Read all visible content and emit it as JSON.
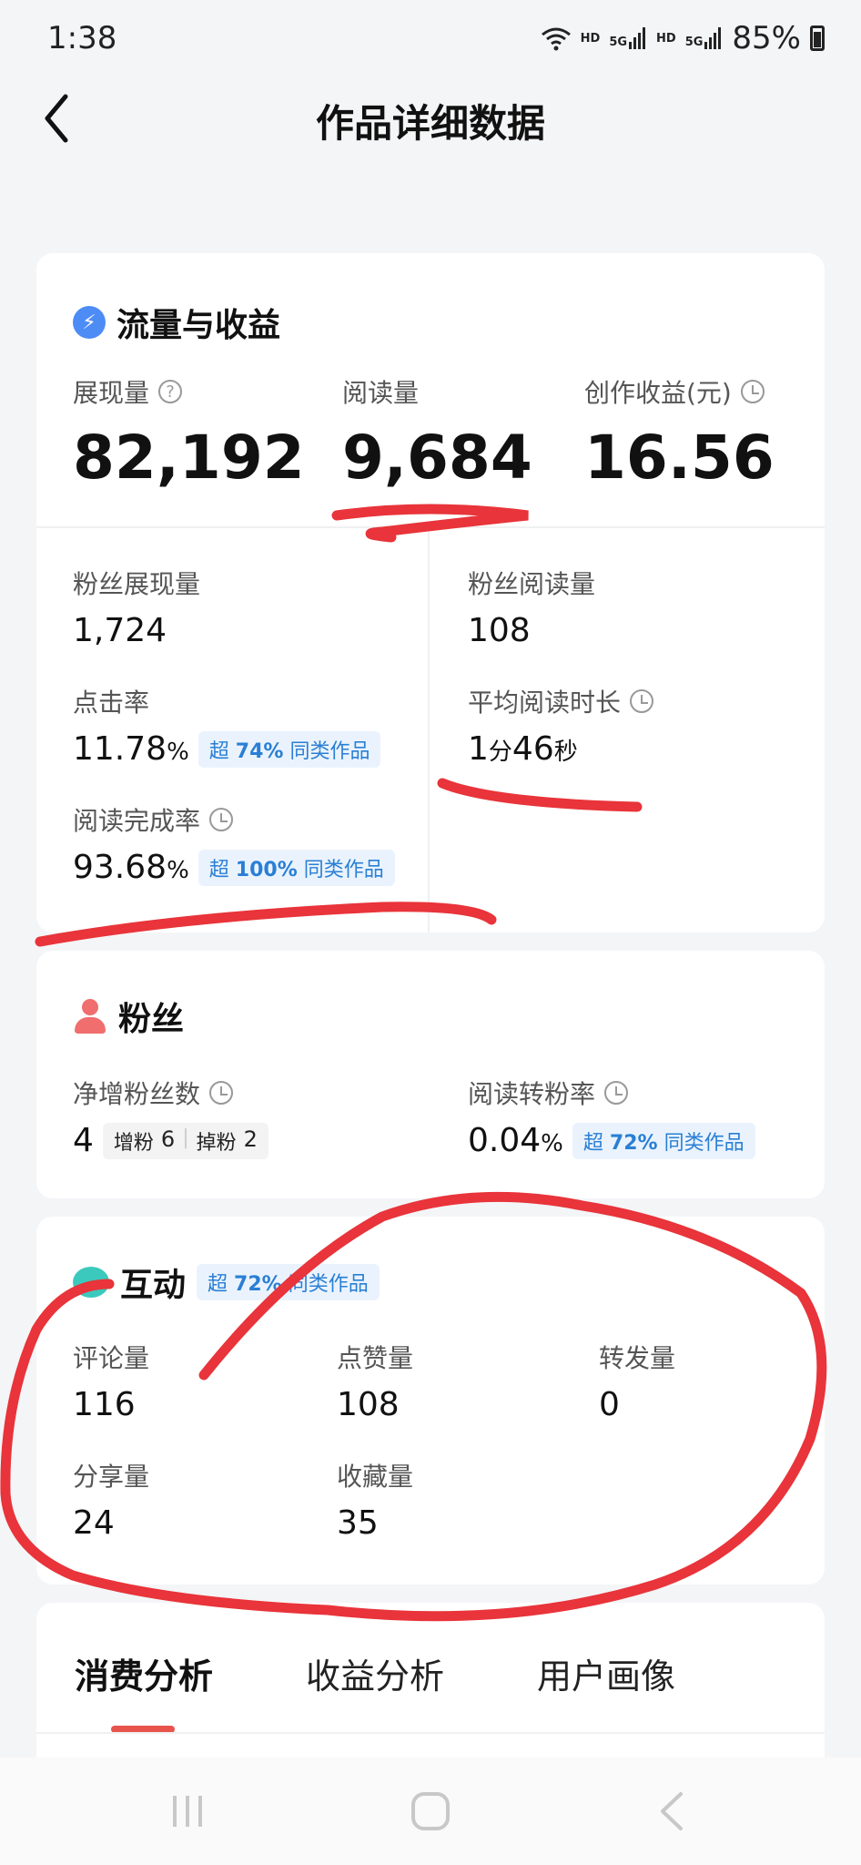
{
  "status_bar": {
    "time": "1:38",
    "net1": "HD",
    "net1_sig": "5G",
    "net2": "HD",
    "net2_sig": "5G",
    "battery": "85%"
  },
  "header": {
    "title": "作品详细数据",
    "back_icon": "back-arrow-icon"
  },
  "traffic": {
    "title": "流量与收益",
    "impressions_label": "展现量",
    "impressions_value": "82,192",
    "reads_label": "阅读量",
    "reads_value": "9,684",
    "revenue_label": "创作收益(元)",
    "revenue_value": "16.56",
    "fan_impressions_label": "粉丝展现量",
    "fan_impressions_value": "1,724",
    "fan_reads_label": "粉丝阅读量",
    "fan_reads_value": "108",
    "ctr_label": "点击率",
    "ctr_value": "11.78",
    "ctr_unit": "%",
    "ctr_badge_prefix": "超",
    "ctr_badge_pct": "74%",
    "ctr_badge_suffix": "同类作品",
    "avg_read_label": "平均阅读时长",
    "avg_read_min": "1",
    "avg_read_min_unit": "分",
    "avg_read_sec": "46",
    "avg_read_sec_unit": "秒",
    "completion_label": "阅读完成率",
    "completion_value": "93.68",
    "completion_unit": "%",
    "completion_badge_prefix": "超",
    "completion_badge_pct": "100%",
    "completion_badge_suffix": "同类作品"
  },
  "fans": {
    "title": "粉丝",
    "net_label": "净增粉丝数",
    "net_value": "4",
    "gain_label": "增粉",
    "gain_value": "6",
    "loss_label": "掉粉",
    "loss_value": "2",
    "conv_label": "阅读转粉率",
    "conv_value": "0.04",
    "conv_unit": "%",
    "conv_badge_prefix": "超",
    "conv_badge_pct": "72%",
    "conv_badge_suffix": "同类作品"
  },
  "interaction": {
    "title": "互动",
    "badge_prefix": "超",
    "badge_pct": "72%",
    "badge_suffix": "同类作品",
    "comments_label": "评论量",
    "comments_value": "116",
    "likes_label": "点赞量",
    "likes_value": "108",
    "reposts_label": "转发量",
    "reposts_value": "0",
    "shares_label": "分享量",
    "shares_value": "24",
    "favorites_label": "收藏量",
    "favorites_value": "35"
  },
  "tabs": [
    {
      "label": "消费分析",
      "active": true
    },
    {
      "label": "收益分析",
      "active": false
    },
    {
      "label": "用户画像",
      "active": false
    }
  ],
  "colors": {
    "accent_blue": "#2a7fd4",
    "badge_bg": "#eaf3fd",
    "tab_underline": "#e8544c",
    "scribble_red": "#e8343a"
  }
}
